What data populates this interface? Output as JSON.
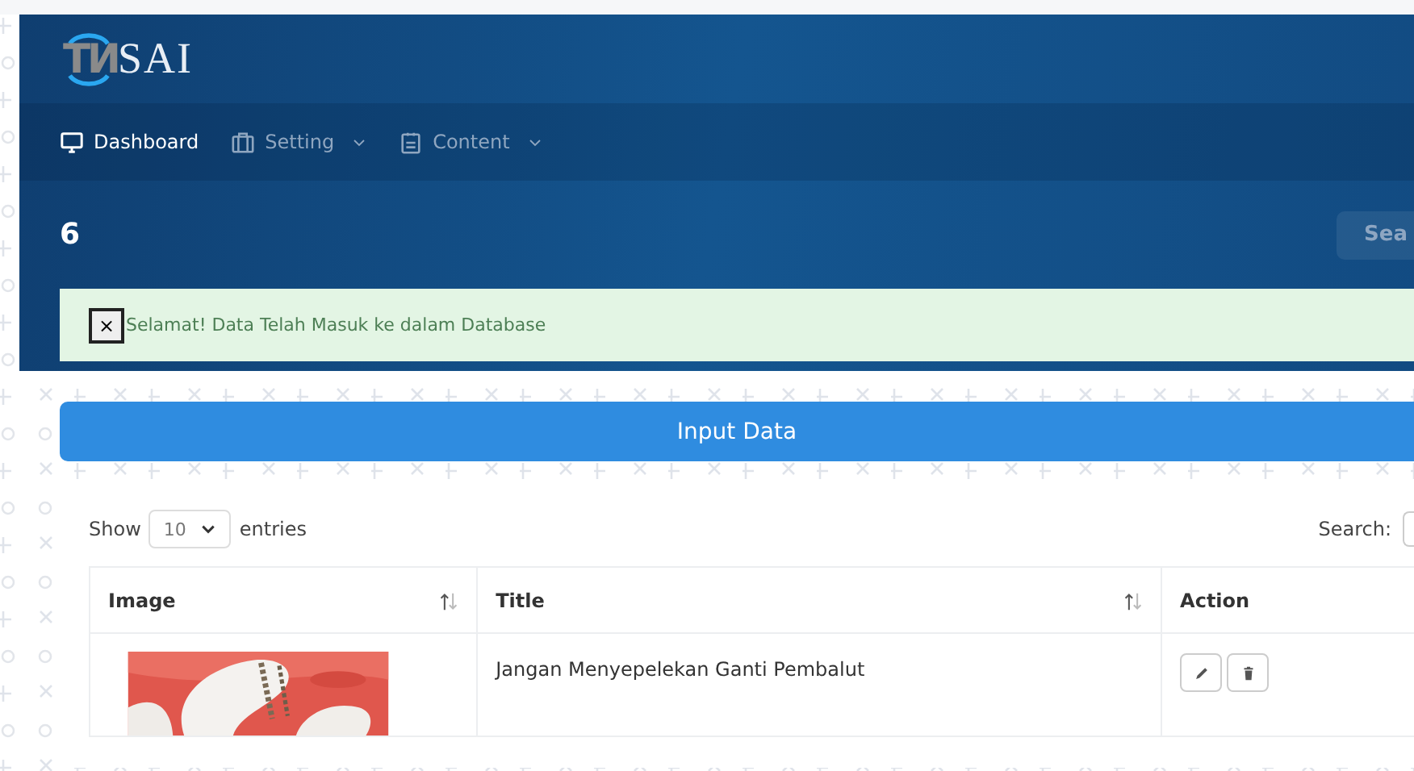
{
  "logo": {
    "mark": "TИ",
    "word": "SAI"
  },
  "nav": [
    {
      "label": "Dashboard",
      "selected": true,
      "has_menu": false
    },
    {
      "label": "Setting",
      "selected": false,
      "has_menu": true
    },
    {
      "label": "Content",
      "selected": false,
      "has_menu": true
    }
  ],
  "page_title": "6",
  "header_button": "Sea",
  "alert": {
    "close": "×",
    "message": "Selamat! Data Telah Masuk ke dalam Database"
  },
  "input_button": "Input Data",
  "table": {
    "length_label_before": "Show",
    "length_value": "10",
    "length_label_after": "entries",
    "search_label": "Search:",
    "columns": [
      {
        "label": "Image",
        "sortable": true
      },
      {
        "label": "Title",
        "sortable": true
      },
      {
        "label": "Action",
        "sortable": false
      }
    ],
    "rows": [
      {
        "image": {
          "kind": "picture"
        },
        "title": "Jangan Menyepelekan Ganti Pembalut",
        "actions": [
          {
            "kind": "edit"
          },
          {
            "kind": "delete"
          }
        ]
      }
    ]
  }
}
